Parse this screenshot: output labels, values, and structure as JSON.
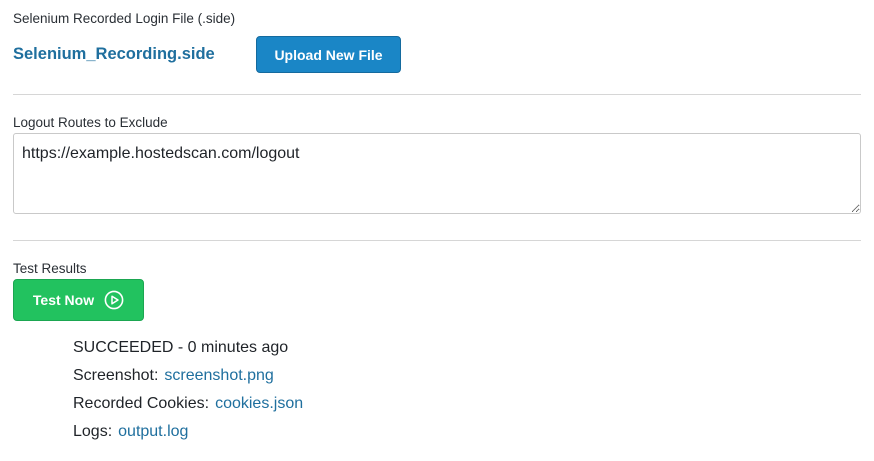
{
  "login_file": {
    "label": "Selenium Recorded Login File (.side)",
    "file_name": "Selenium_Recording.side",
    "upload_button_label": "Upload New File"
  },
  "logout_routes": {
    "label": "Logout Routes to Exclude",
    "value": "https://example.hostedscan.com/logout"
  },
  "test_results": {
    "label": "Test Results",
    "test_button_label": "Test Now",
    "test_button_icon": "play-circle-icon",
    "status": "SUCCEEDED - 0 minutes ago",
    "screenshot_label": "Screenshot:",
    "screenshot_link": "screenshot.png",
    "cookies_label": "Recorded Cookies:",
    "cookies_link": "cookies.json",
    "logs_label": "Logs:",
    "logs_link": "output.log"
  },
  "colors": {
    "link": "#1f6f9e",
    "upload_button": "#1a86c6",
    "test_button": "#22c25f"
  }
}
